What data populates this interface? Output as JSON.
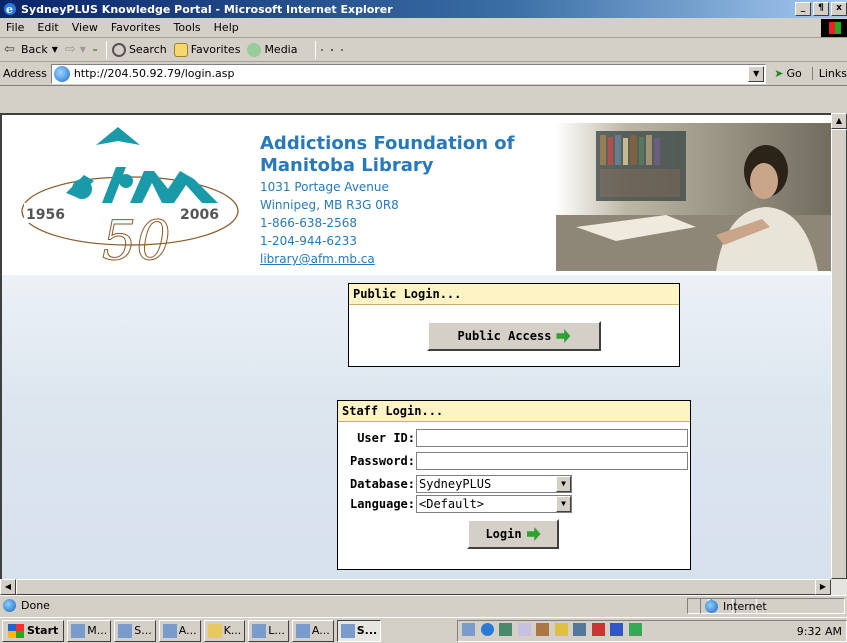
{
  "window": {
    "title": "SydneyPLUS Knowledge Portal - Microsoft Internet Explorer",
    "controls": [
      "_",
      "¶",
      "x"
    ]
  },
  "menu": [
    "File",
    "Edit",
    "View",
    "Favorites",
    "Tools",
    "Help"
  ],
  "toolbar": {
    "back": "Back",
    "search": "Search",
    "favorites": "Favorites",
    "media": "Media"
  },
  "address": {
    "label": "Address",
    "url": "http://204.50.92.79/login.asp",
    "go": "Go",
    "links": "Links"
  },
  "org": {
    "name_line1": "Addictions Foundation of",
    "name_line2": "Manitoba Library",
    "street": "1031 Portage Avenue",
    "city": "Winnipeg, MB R3G 0R8",
    "phone1": "1-866-638-2568",
    "phone2": "1-204-944-6233",
    "email": "library@afm.mb.ca"
  },
  "logo": {
    "year_start": "1956",
    "year_end": "2006",
    "anniversary": "50",
    "brand_color": "#1a9aa8"
  },
  "public_login": {
    "header": "Public Login...",
    "button": "Public Access"
  },
  "staff_login": {
    "header": "Staff Login...",
    "user_id_label": "User ID:",
    "password_label": "Password:",
    "database_label": "Database:",
    "database_value": "SydneyPLUS",
    "language_label": "Language:",
    "language_value": "<Default>",
    "login_button": "Login"
  },
  "status": {
    "text": "Done",
    "zone": "Internet"
  },
  "taskbar": {
    "start": "Start",
    "tasks": [
      "M...",
      "S...",
      "A...",
      "K...",
      "L...",
      "A...",
      "S..."
    ],
    "clock": "9:32 AM"
  }
}
